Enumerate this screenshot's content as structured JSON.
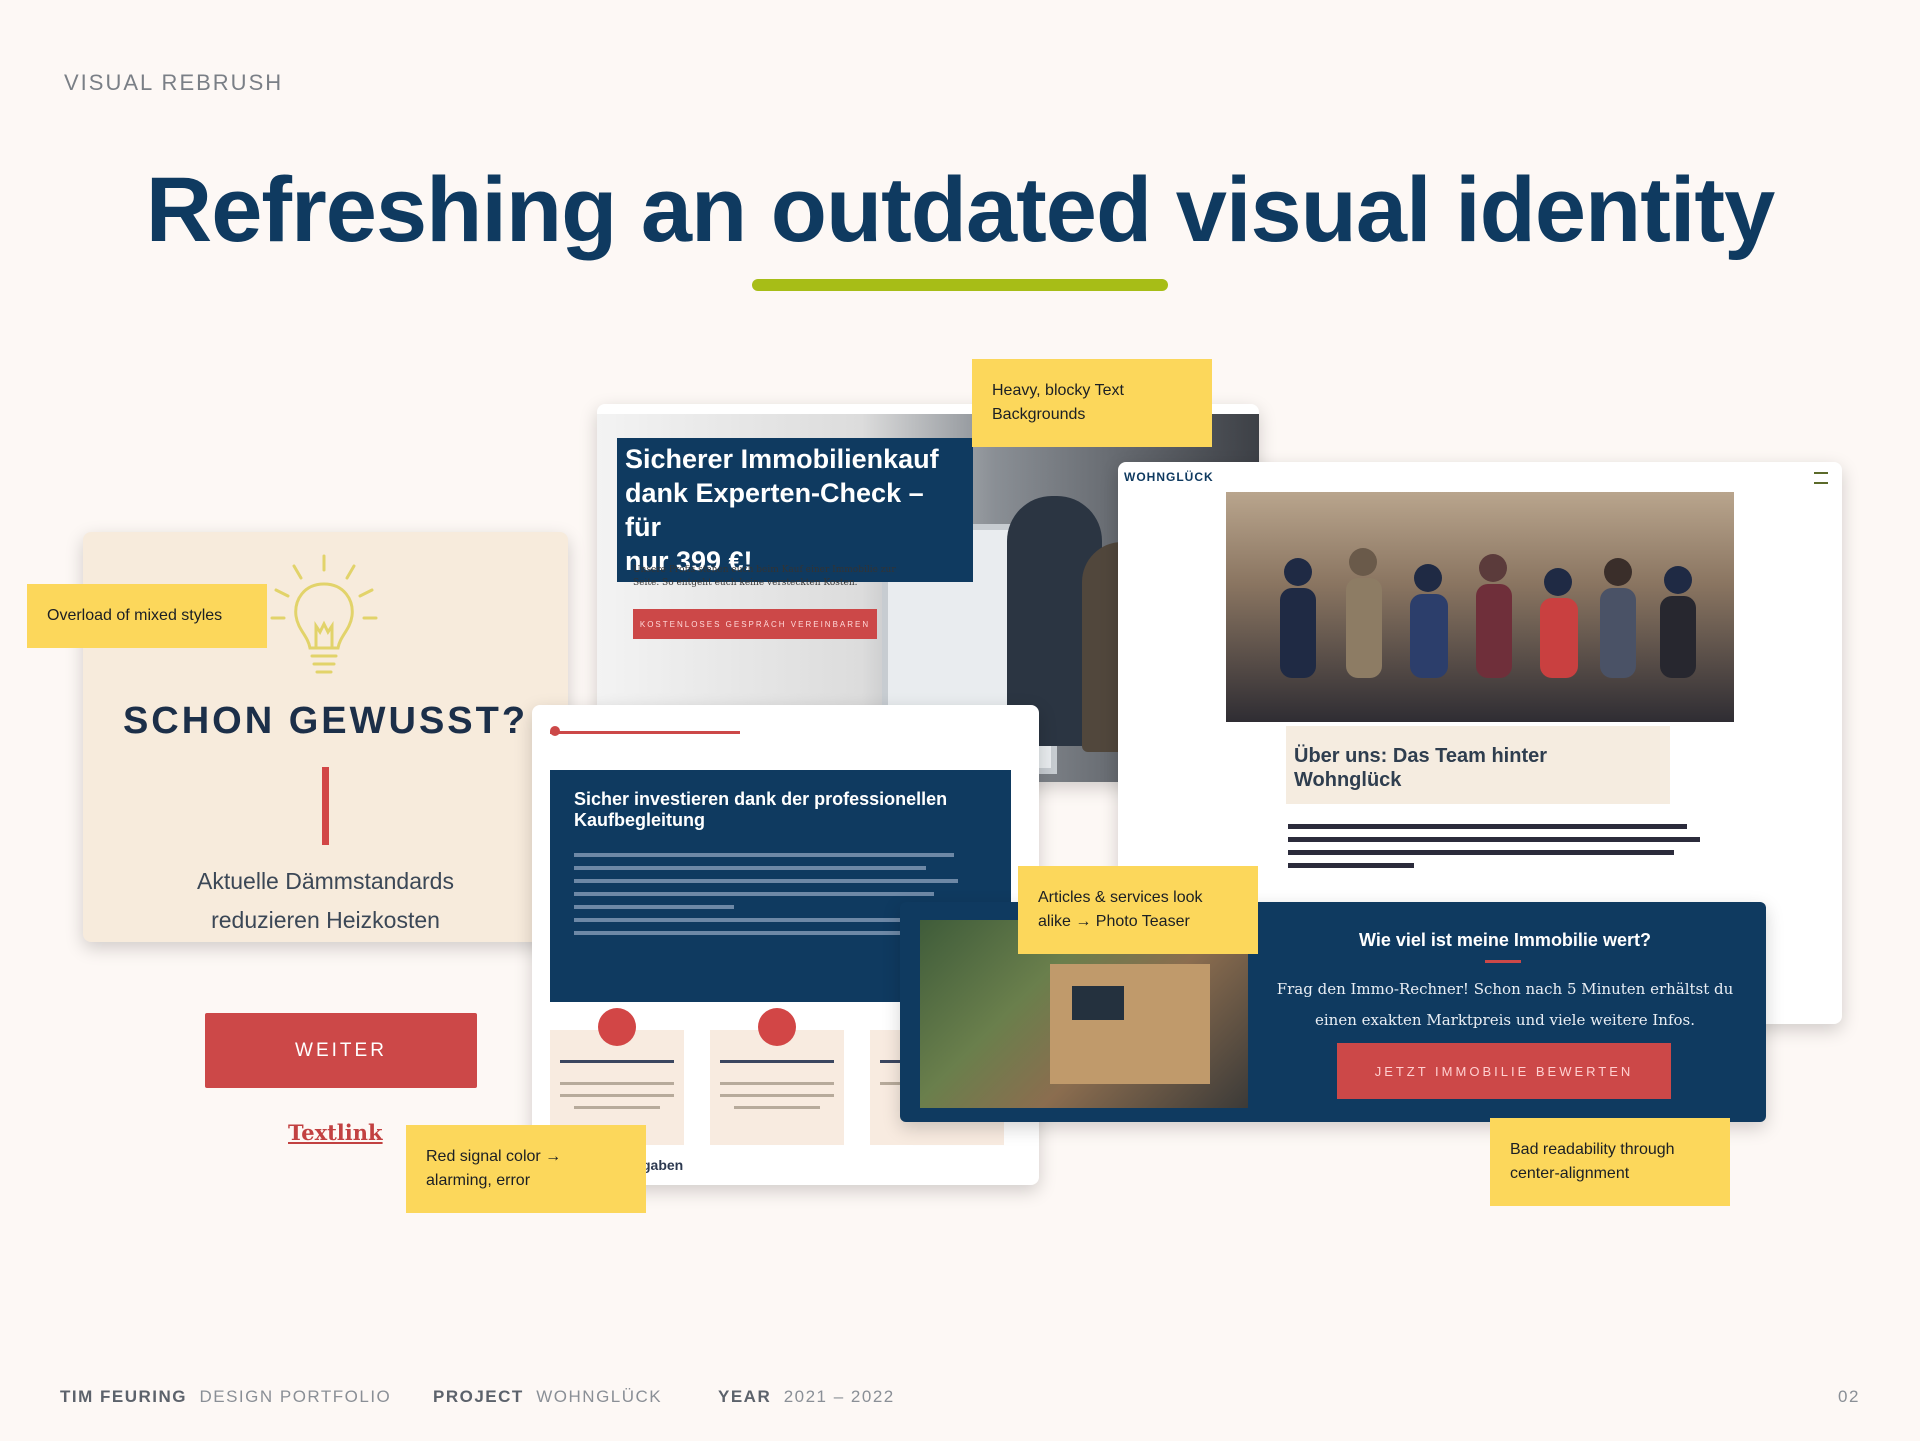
{
  "eyebrow": "VISUAL REBRUSH",
  "title": "Refreshing an outdated visual identity",
  "colors": {
    "accent_underline": "#a7bd17",
    "navy": "#0f3a60",
    "signal_red": "#cc4848",
    "note_yellow": "#fcd75b"
  },
  "info_card": {
    "icon": "lightbulb-icon",
    "title": "SCHON GEWUSST?",
    "text_line1": "Aktuelle Dämmstandards",
    "text_line2": "reduzieren Heizkosten"
  },
  "weiter_button": "WEITER",
  "textlink": "Textlink",
  "hero_card": {
    "headline_line1": "Sicherer Immobilienkauf",
    "headline_line2": "dank Experten-Check – für",
    "headline_line3": "nur 399 €!",
    "body": "Unsere Profis stehen euch beim Kauf einer Immobilie zur Seite. So entgeht euch keine versteckten Kosten.",
    "button": "KOSTENLOSES GESPRÄCH VEREINBAREN"
  },
  "team_card": {
    "logo": "WOHNGLÜCK",
    "caption": "Über uns: Das Team hinter Wohnglück"
  },
  "invest_card": {
    "title": "Sicher investieren dank der professionellen Kaufbegleitung",
    "footer": "gaben"
  },
  "value_card": {
    "title": "Wie viel ist meine Immobilie wert?",
    "text": "Frag den Immo-Rechner! Schon nach 5 Minuten erhältst du einen exakten Marktpreis und viele weitere Infos.",
    "button": "JETZT IMMOBILIE BEWERTEN"
  },
  "notes": {
    "blocky": "Heavy, blocky Text Backgrounds",
    "mixed": "Overload of mixed styles",
    "articles": "Articles & services look alike → Photo Teaser",
    "red": "Red signal color → alarming, error",
    "readability": "Bad readability through center-alignment"
  },
  "footer": {
    "name_label": "TIM FEURING",
    "name_value": "DESIGN PORTFOLIO",
    "project_label": "PROJECT",
    "project_value": "WOHNGLÜCK",
    "year_label": "YEAR",
    "year_value": "2021 – 2022",
    "page": "02"
  }
}
